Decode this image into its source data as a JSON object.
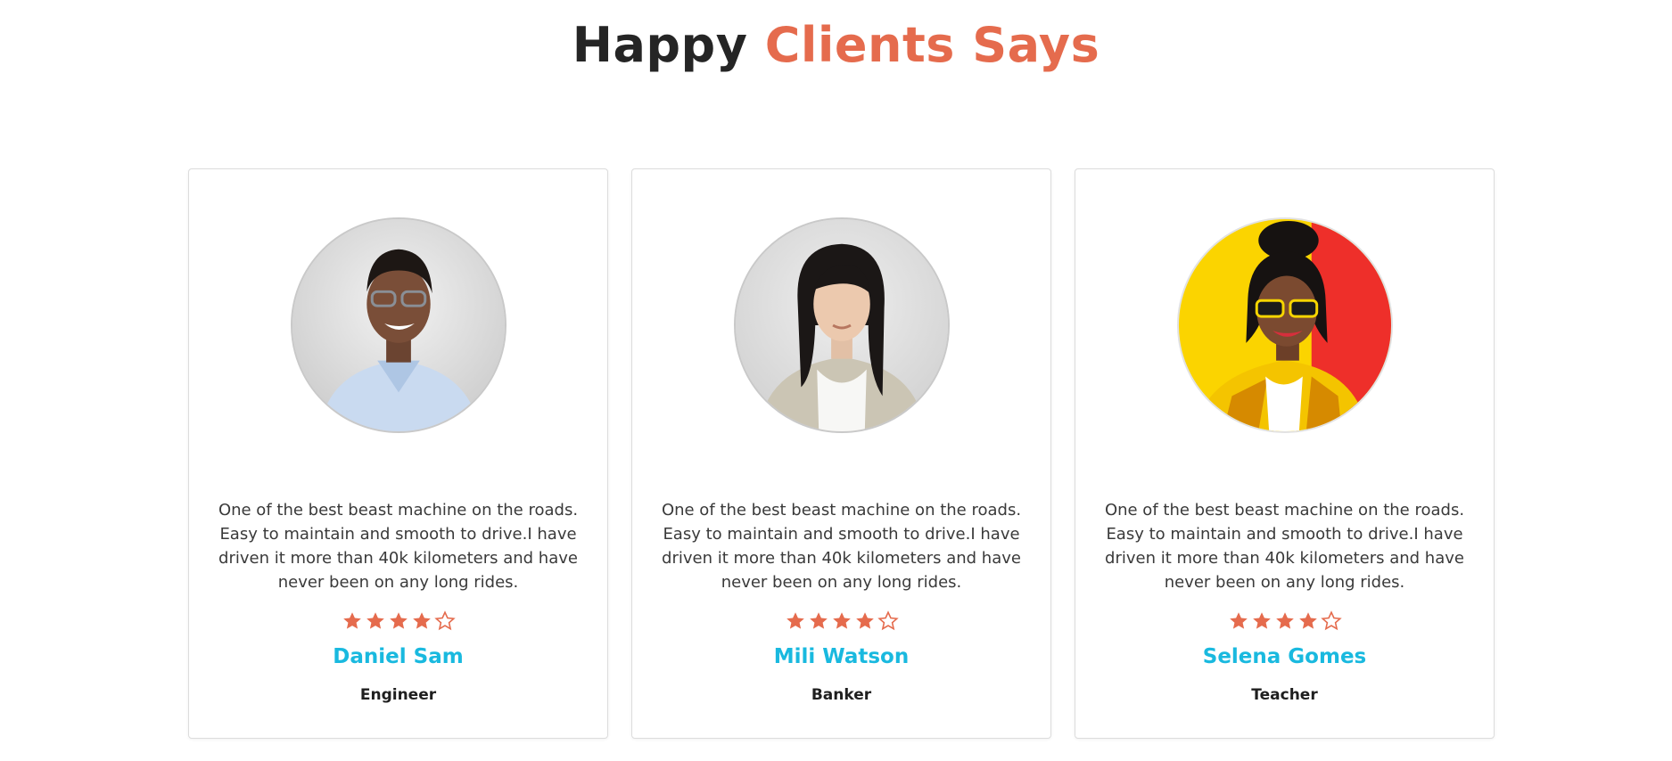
{
  "heading": {
    "part1": "Happy",
    "part2": "Clients Says"
  },
  "colors": {
    "accent": "#e56b4d",
    "name": "#19b9df",
    "text": "#252525"
  },
  "testimonials": [
    {
      "quote": "One of the best beast machine on the roads. Easy to maintain and smooth to drive.I have driven it more than 40k kilometers and have never been on any long rides.",
      "rating": 4,
      "max_rating": 5,
      "name": "Daniel Sam",
      "role": "Engineer"
    },
    {
      "quote": "One of the best beast machine on the roads. Easy to maintain and smooth to drive.I have driven it more than 40k kilometers and have never been on any long rides.",
      "rating": 4,
      "max_rating": 5,
      "name": "Mili Watson",
      "role": "Banker"
    },
    {
      "quote": "One of the best beast machine on the roads. Easy to maintain and smooth to drive.I have driven it more than 40k kilometers and have never been on any long rides.",
      "rating": 4,
      "max_rating": 5,
      "name": "Selena Gomes",
      "role": "Teacher"
    }
  ]
}
